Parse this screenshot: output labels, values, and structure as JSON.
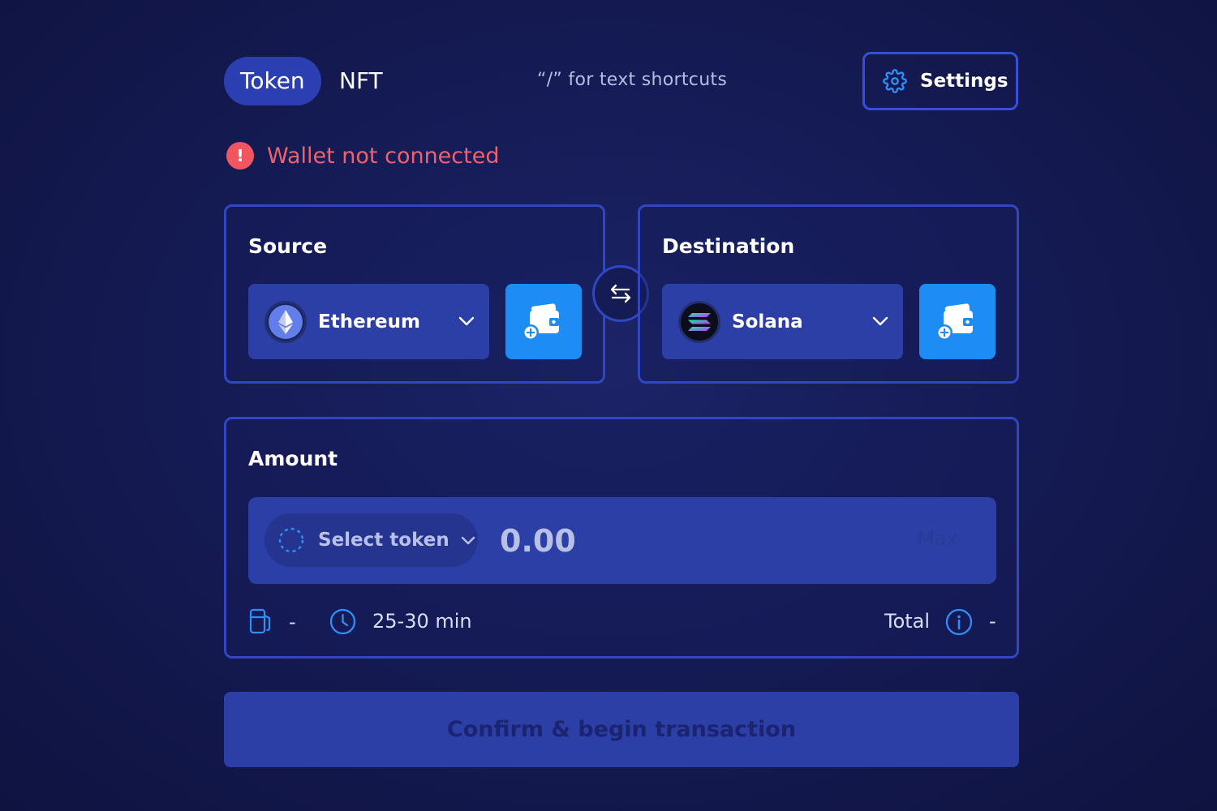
{
  "tabs": [
    {
      "label": "Token",
      "active": true
    },
    {
      "label": "NFT",
      "active": false
    }
  ],
  "shortcuts_hint": "“/” for text shortcuts",
  "settings": {
    "label": "Settings",
    "icon": "gear-icon"
  },
  "warning": {
    "text": "Wallet not connected",
    "icon": "exclamation-icon",
    "color": "#f0626b"
  },
  "source": {
    "title": "Source",
    "chain": {
      "name": "Ethereum",
      "icon": "ethereum-icon"
    },
    "wallet_button_icon": "add-wallet-icon"
  },
  "swap_icon": "swap-arrows-icon",
  "destination": {
    "title": "Destination",
    "chain": {
      "name": "Solana",
      "icon": "solana-icon"
    },
    "wallet_button_icon": "add-wallet-icon"
  },
  "amount": {
    "title": "Amount",
    "token_select_label": "Select token",
    "input_placeholder": "0.00",
    "input_value": "",
    "max_label": "Max",
    "gas_fee": "-",
    "time_estimate": "25-30 min",
    "total_label": "Total",
    "total_value": "-"
  },
  "confirm_button": "Confirm & begin transaction",
  "colors": {
    "accent": "#1e8cf5",
    "panel_border": "#3147c2",
    "active_tab": "#2c3fb2",
    "warning": "#f0565f"
  }
}
